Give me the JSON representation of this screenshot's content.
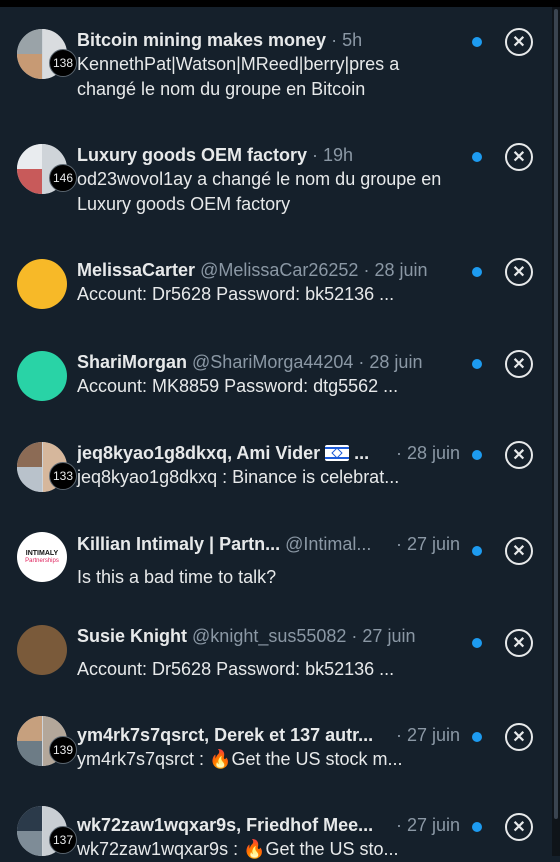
{
  "colors": {
    "background": "#15202b",
    "unread_dot": "#1d9bf0",
    "text": "#e7e9ea",
    "muted": "#8b98a5"
  },
  "rows": [
    {
      "name": "Bitcoin mining makes money",
      "handle": "",
      "time": "5h",
      "count": "138",
      "message": "KennethPat|Watson|MReed|berry|pres a changé le nom du groupe en Bitcoin"
    },
    {
      "name": "Luxury goods OEM factory",
      "handle": "",
      "time": "19h",
      "count": "146",
      "message": "od23wovol1ay a changé le nom du groupe en Luxury goods OEM factory"
    },
    {
      "name": "MelissaCarter",
      "handle": "@MelissaCar26252",
      "time": "28 juin",
      "count": "",
      "message": "Account: Dr5628 Password: bk52136 ..."
    },
    {
      "name": "ShariMorgan",
      "handle": "@ShariMorga44204",
      "time": "28 juin",
      "count": "",
      "message": "Account: MK8859 Password: dtg5562 ..."
    },
    {
      "name": "jeq8kyao1g8dkxq, Ami Vider",
      "name_suffix": "...",
      "handle": "",
      "time": "28 juin",
      "count": "133",
      "message": "jeq8kyao1g8dkxq : Binance is celebrat..."
    },
    {
      "name": "Killian Intimaly | Partn...",
      "handle": "@Intimal...",
      "time": "27 juin",
      "count": "",
      "message": "Is this a bad time to talk?",
      "logo_top": "INTIMALY",
      "logo_bottom": "Partnerships"
    },
    {
      "name": "Susie Knight",
      "handle": "@knight_sus55082",
      "time": "27 juin",
      "count": "",
      "message": "Account: Dr5628 Password: bk52136 ..."
    },
    {
      "name": "ym4rk7s7qsrct, Derek et 137 autr...",
      "handle": "",
      "time": "27 juin",
      "count": "139",
      "message_prefix": "ym4rk7s7qsrct : ",
      "message": "Get the US stock m..."
    },
    {
      "name": "wk72zaw1wqxar9s, Friedhof Mee...",
      "handle": "",
      "time": "27 juin",
      "count": "137",
      "message_prefix": "wk72zaw1wqxar9s : ",
      "message": "Get the US sto..."
    }
  ],
  "icons": {
    "close": "close-x-icon",
    "fire": "fire-emoji-icon",
    "flag": "israel-flag-icon"
  }
}
